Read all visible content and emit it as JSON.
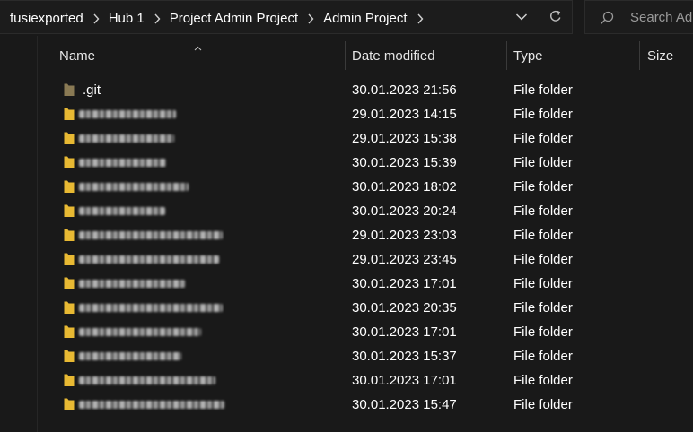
{
  "breadcrumb": {
    "items": [
      "fusiexported",
      "Hub 1",
      "Project Admin Project",
      "Admin Project"
    ]
  },
  "search": {
    "placeholder": "Search Admin Project"
  },
  "columns": {
    "name": "Name",
    "date_modified": "Date modified",
    "type": "Type",
    "size": "Size"
  },
  "icons": {
    "separator": "chevron-right-icon",
    "history": "chevron-down-icon",
    "refresh": "refresh-icon",
    "search": "search-icon",
    "sort": "sort-up-icon",
    "folder": "folder-icon"
  },
  "colors": {
    "folder_yellow": "#e8b934",
    "git_folder": "#8a7a55",
    "background": "#191919"
  },
  "files": [
    {
      "name": ".git",
      "date": "30.01.2023 21:56",
      "type": "File folder",
      "size": "",
      "redacted": false
    },
    {
      "name": "",
      "date": "29.01.2023 14:15",
      "type": "File folder",
      "size": "",
      "redacted": true
    },
    {
      "name": "",
      "date": "29.01.2023 15:38",
      "type": "File folder",
      "size": "",
      "redacted": true
    },
    {
      "name": "",
      "date": "30.01.2023 15:39",
      "type": "File folder",
      "size": "",
      "redacted": true
    },
    {
      "name": "",
      "date": "30.01.2023 18:02",
      "type": "File folder",
      "size": "",
      "redacted": true
    },
    {
      "name": "",
      "date": "30.01.2023 20:24",
      "type": "File folder",
      "size": "",
      "redacted": true
    },
    {
      "name": "",
      "date": "29.01.2023 23:03",
      "type": "File folder",
      "size": "",
      "redacted": true
    },
    {
      "name": "",
      "date": "29.01.2023 23:45",
      "type": "File folder",
      "size": "",
      "redacted": true
    },
    {
      "name": "",
      "date": "30.01.2023 17:01",
      "type": "File folder",
      "size": "",
      "redacted": true
    },
    {
      "name": "",
      "date": "30.01.2023 20:35",
      "type": "File folder",
      "size": "",
      "redacted": true
    },
    {
      "name": "",
      "date": "30.01.2023 17:01",
      "type": "File folder",
      "size": "",
      "redacted": true
    },
    {
      "name": "",
      "date": "30.01.2023 15:37",
      "type": "File folder",
      "size": "",
      "redacted": true
    },
    {
      "name": "",
      "date": "30.01.2023 17:01",
      "type": "File folder",
      "size": "",
      "redacted": true
    },
    {
      "name": "",
      "date": "30.01.2023 15:47",
      "type": "File folder",
      "size": "",
      "redacted": true
    }
  ]
}
